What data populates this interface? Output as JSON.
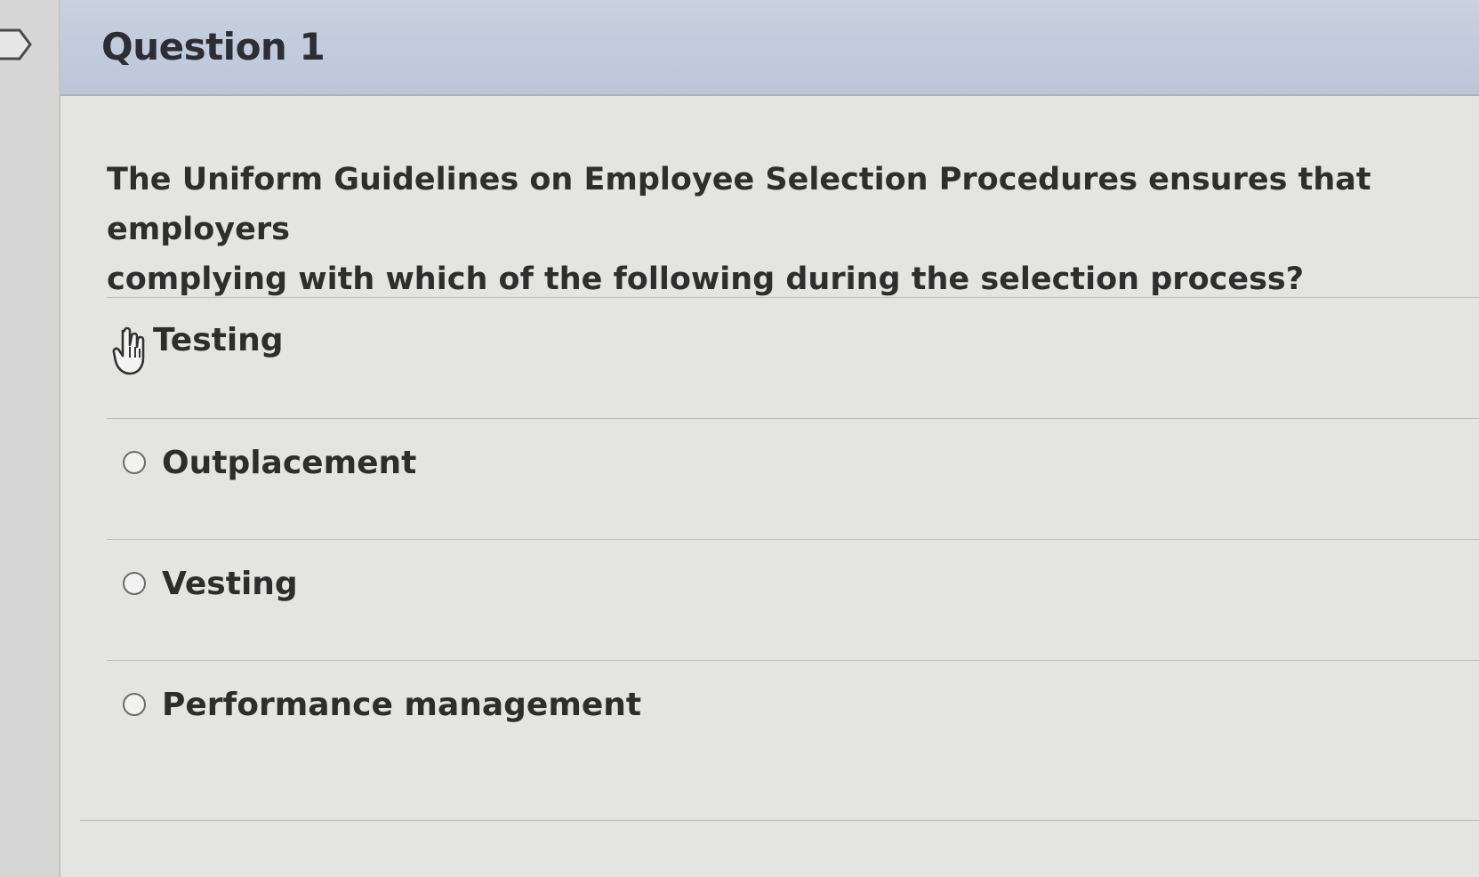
{
  "question": {
    "title": "Question 1",
    "text": "The Uniform Guidelines on Employee Selection Procedures ensures that employers\ncomplying with which of the following during the selection process?"
  },
  "answers": [
    {
      "label": "Testing",
      "icon": "hand-pointer-cursor-icon"
    },
    {
      "label": "Outplacement",
      "icon": "radio-button-icon"
    },
    {
      "label": "Vesting",
      "icon": "radio-button-icon"
    },
    {
      "label": "Performance management",
      "icon": "radio-button-icon"
    }
  ],
  "colors": {
    "header_bg": "#bcc6d8",
    "panel_bg": "#e4e4e2",
    "text": "#2e2e2e"
  }
}
